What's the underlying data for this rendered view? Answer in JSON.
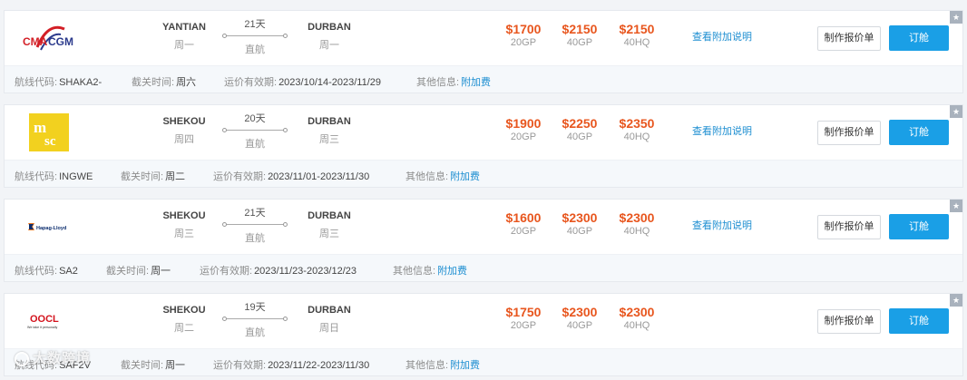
{
  "labels": {
    "route_code": "航线代码:",
    "cutoff": "截关时间:",
    "validity": "运价有效期:",
    "other": "其他信息:",
    "surcharge_info": "附加费",
    "view_surcharge": "查看附加说明",
    "make_quote": "制作报价单",
    "book": "订舱"
  },
  "watermark": "大数跨境",
  "colors": {
    "price": "#e8561e",
    "link": "#1d8ed1",
    "book_button": "#1a9fe6",
    "card_bottom_bg": "#f5f8fb"
  },
  "rates": [
    {
      "carrier": "CMA CGM",
      "logo_text_a": "CMA",
      "logo_text_b": "CGM",
      "origin": "YANTIAN",
      "origin_day": "周一",
      "transit": "21天",
      "route_type": "直航",
      "destination": "DURBAN",
      "destination_day": "周一",
      "prices": [
        {
          "amount": "$1700",
          "type": "20GP"
        },
        {
          "amount": "$2150",
          "type": "40GP"
        },
        {
          "amount": "$2150",
          "type": "40HQ"
        }
      ],
      "route_code": "SHAKA2-",
      "cutoff": "周六",
      "validity": "2023/10/14-2023/11/29"
    },
    {
      "carrier": "MSC",
      "logo_text_a": "m",
      "logo_text_b": "sc",
      "origin": "SHEKOU",
      "origin_day": "周四",
      "transit": "20天",
      "route_type": "直航",
      "destination": "DURBAN",
      "destination_day": "周三",
      "prices": [
        {
          "amount": "$1900",
          "type": "20GP"
        },
        {
          "amount": "$2250",
          "type": "40GP"
        },
        {
          "amount": "$2350",
          "type": "40HQ"
        }
      ],
      "route_code": "INGWE",
      "cutoff": "周二",
      "validity": "2023/11/01-2023/11/30"
    },
    {
      "carrier": "Hapag-Lloyd",
      "logo_text_a": "Hapag-Lloyd",
      "logo_text_b": "",
      "origin": "SHEKOU",
      "origin_day": "周三",
      "transit": "21天",
      "route_type": "直航",
      "destination": "DURBAN",
      "destination_day": "周三",
      "prices": [
        {
          "amount": "$1600",
          "type": "20GP"
        },
        {
          "amount": "$2300",
          "type": "40GP"
        },
        {
          "amount": "$2300",
          "type": "40HQ"
        }
      ],
      "route_code": "SA2",
      "cutoff": "周一",
      "validity": "2023/11/23-2023/12/23"
    },
    {
      "carrier": "OOCL",
      "logo_text_a": "OOCL",
      "logo_text_b": "We take it personally",
      "origin": "SHEKOU",
      "origin_day": "周二",
      "transit": "19天",
      "route_type": "直航",
      "destination": "DURBAN",
      "destination_day": "周日",
      "prices": [
        {
          "amount": "$1750",
          "type": "20GP"
        },
        {
          "amount": "$2300",
          "type": "40GP"
        },
        {
          "amount": "$2300",
          "type": "40HQ"
        }
      ],
      "route_code": "SAF2V",
      "cutoff": "周一",
      "validity": "2023/11/22-2023/11/30"
    }
  ]
}
